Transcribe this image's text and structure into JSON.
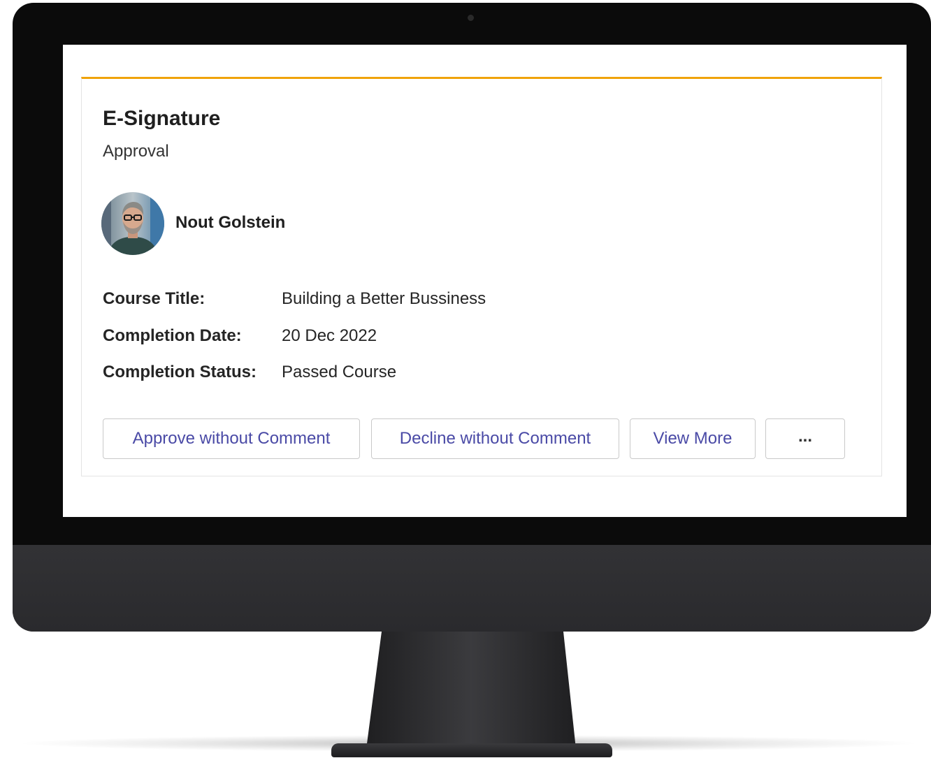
{
  "card": {
    "title": "E-Signature",
    "subtitle": "Approval",
    "accent_color": "#f0a30a",
    "user": {
      "name": "Nout Golstein"
    },
    "facts": [
      {
        "label": "Course Title:",
        "value": "Building a Better Bussiness"
      },
      {
        "label": "Completion Date:",
        "value": "20 Dec 2022"
      },
      {
        "label": "Completion Status:",
        "value": "Passed Course"
      }
    ],
    "actions": {
      "approve_label": "Approve without Comment",
      "decline_label": "Decline without Comment",
      "view_more_label": "View More",
      "more_label": "..."
    }
  },
  "colors": {
    "button_text": "#4a4aa6",
    "monitor_bezel": "#0b0b0b",
    "monitor_chin": "#2e2e31"
  }
}
